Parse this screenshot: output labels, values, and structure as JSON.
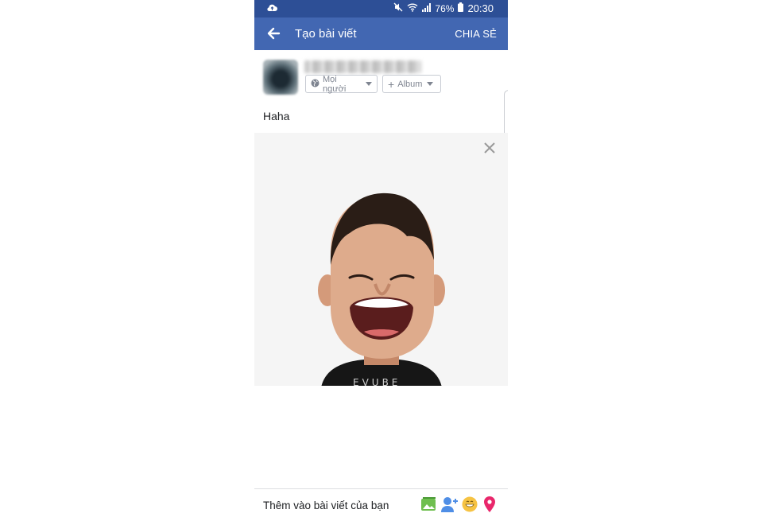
{
  "status_bar": {
    "battery_percent": "76%",
    "time": "20:30",
    "icons": [
      "cloud-upload-icon",
      "mute-icon",
      "wifi-icon",
      "signal-icon",
      "battery-icon"
    ]
  },
  "header": {
    "title": "Tạo bài viết",
    "share_label": "CHIA SẺ",
    "back_icon": "arrow-left-icon",
    "background": "#4267b2"
  },
  "composer": {
    "audience_label": "Mọi người",
    "album_label": "Album",
    "post_text": "Haha"
  },
  "attachment": {
    "type": "avatar-sticker",
    "close_icon": "close-icon"
  },
  "bottom_bar": {
    "label": "Thêm vào bài viết của bạn",
    "icons": [
      "photo-icon",
      "tag-people-icon",
      "feeling-icon",
      "location-icon"
    ]
  }
}
